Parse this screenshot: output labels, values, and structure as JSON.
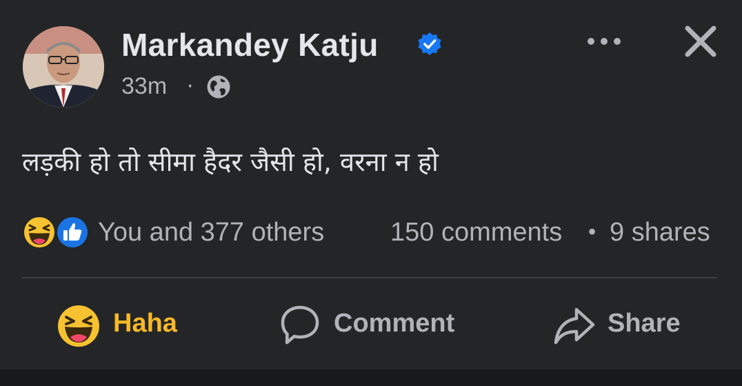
{
  "author": {
    "name": "Markandey Katju",
    "verified": true
  },
  "meta": {
    "time": "33m",
    "separator": "·",
    "privacy_icon": "globe-icon"
  },
  "header_actions": {
    "more_icon": "more-horizontal-icon",
    "close_icon": "close-icon"
  },
  "post": {
    "text": "लड़की हो तो सीमा हैदर जैसी हो, वरना न हो"
  },
  "stats": {
    "reaction_icons": [
      "haha-reaction-icon",
      "like-reaction-icon"
    ],
    "reactors": "You and 377 others",
    "comments": "150 comments",
    "separator": "•",
    "shares": "9 shares"
  },
  "actions": {
    "reaction_label": "Haha",
    "comment_label": "Comment",
    "share_label": "Share"
  },
  "colors": {
    "background": "#242526",
    "text_primary": "#e4e6eb",
    "text_secondary": "#b0b3b8",
    "verified_blue": "#1877f2",
    "haha_yellow": "#f7b928",
    "divider": "#3e4042"
  }
}
